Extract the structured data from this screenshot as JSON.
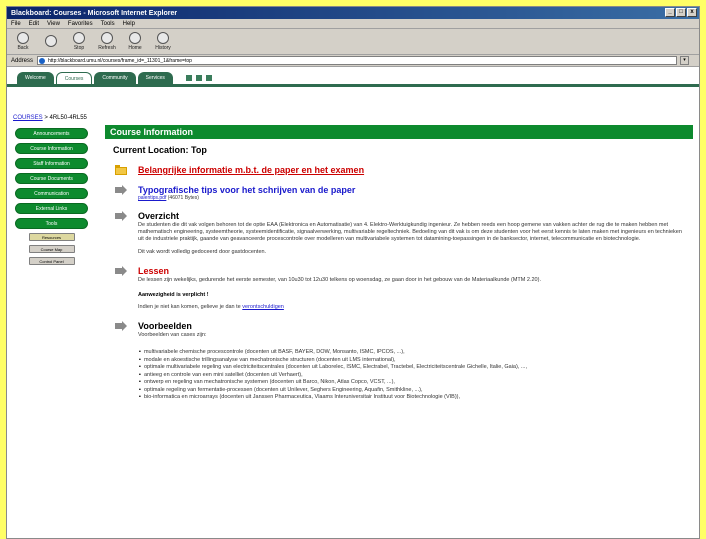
{
  "window": {
    "title": "Blackboard: Courses - Microsoft Internet Explorer",
    "controls": [
      "_",
      "□",
      "x"
    ]
  },
  "menu": [
    "File",
    "Edit",
    "View",
    "Favorites",
    "Tools",
    "Help"
  ],
  "toolbar": [
    "Back",
    "",
    "Stop",
    "Refresh",
    "Home",
    "History"
  ],
  "address": {
    "label": "Address",
    "value": "http://blackboard.umu.nl/courses/frame_id=_11301_1&frame=top",
    "go": "▾"
  },
  "nav_tabs": [
    {
      "label": "Welcome",
      "active": false
    },
    {
      "label": "Courses",
      "active": true
    },
    {
      "label": "Community",
      "active": false
    },
    {
      "label": "Services",
      "active": false
    }
  ],
  "breadcrumb": {
    "link": "COURSES",
    "sep": " > ",
    "current": "4RL50-4RL55"
  },
  "sidebar": {
    "buttons": [
      "Announcements",
      "Course Information",
      "Staff Information",
      "Course Documents",
      "Communication",
      "External Links",
      "Tools"
    ],
    "small": [
      "Resources",
      "Course Map",
      "Control Panel"
    ]
  },
  "main": {
    "header": "Course Information",
    "location": "Current Location: Top",
    "items": [
      {
        "title": "Belangrijke informatie m.b.t. de paper en het examen"
      },
      {
        "title": "Typografische tips voor het schrijven van de paper",
        "file": "palentips.pdf",
        "size": "(46071 Bytes)"
      },
      {
        "title": "Overzicht",
        "text": "De studenten die dit vak volgen behoren tot de optie EAA (Elektronica en Automatisatie) van 4. Elektro-Werktuigkundig ingenieur. Ze hebben reeds een hoop gemene van vakken achter de rug die te maken hebben met mathematisch engineering, systeemtheorie, systeemidentificatie, signaalverwerking, multivariable regeltechniek. Bedoeling van dit vak is om deze studenten voor het eerst kennis te laten maken met ingenieurs en technieken uit de industriele praktijk, gaande van geavanceerde procescontrole over modelleren van multivariabele systemen tot datamining-toepassingen in de banksector, internet, telecommunicatie en biotechnologie.",
        "text2": "Dit vak wordt volledig gedoceerd door gastdocenten."
      },
      {
        "title": "Lessen",
        "text": "De lessen zijn wekelijks, gedurende het eerste semester, van 10u30 tot 12u30 telkens op woensdag, ze gaan door in het gebouw van de Materiaalkunde (MTM 2.20).",
        "bold": "Aanwezigheid is verplicht !",
        "text2": "Indien je niet kan komen, gelieve je dan te",
        "link": "verontschuldigen"
      },
      {
        "title": "Voorbeelden",
        "text": "Voorbeelden van cases zijn:",
        "bullets": [
          "multivariabele chemische procescontrole (docenten uit BASF, BAYER, DOW, Monsanto, ISMC, IPCOS, ...),",
          "modale en akoestische trillingsanalyse van mechatronische structuren (docenten uit LMS international),",
          "optimale multivariabele regeling van electriciteitscentrales (docenten uit Laborelec, ISMC, Electrabel, Tractebel, Electriciteitscentrale Gichelle, Italie, Gaia), ...,",
          "antieeg en controle van een mini satelliet (docenten uit Verhaert),",
          "ontwerp en regeling van mechatronische systemen (docenten uit Barco, Nikon, Atlas Copco, VCST, ...),",
          "optimale regeling van fermentatie-processen (docenten uit Unilever, Seghers Engineering, Aquafin, Smithkline, ...),",
          "bio-informatica en microarrays (docenten uit Janssen Pharmaceutica, Vlaams Interuniversitair Instituut voor Biotechnologie (VIB)),"
        ]
      }
    ]
  }
}
